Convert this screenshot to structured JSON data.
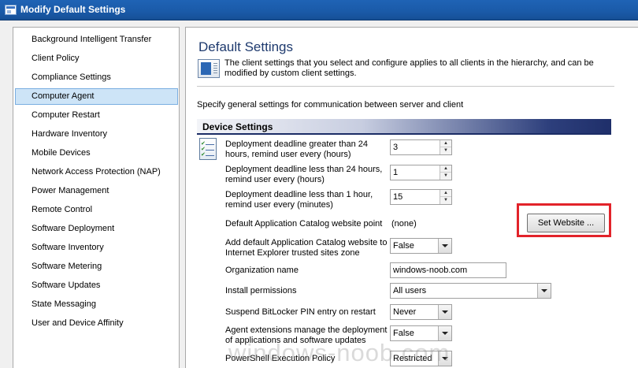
{
  "window": {
    "title": "Modify Default Settings"
  },
  "sidebar": {
    "items": [
      {
        "label": "Background Intelligent Transfer"
      },
      {
        "label": "Client Policy"
      },
      {
        "label": "Compliance Settings"
      },
      {
        "label": "Computer Agent",
        "selected": true
      },
      {
        "label": "Computer Restart"
      },
      {
        "label": "Hardware Inventory"
      },
      {
        "label": "Mobile Devices"
      },
      {
        "label": "Network Access Protection (NAP)"
      },
      {
        "label": "Power Management"
      },
      {
        "label": "Remote Control"
      },
      {
        "label": "Software Deployment"
      },
      {
        "label": "Software Inventory"
      },
      {
        "label": "Software Metering"
      },
      {
        "label": "Software Updates"
      },
      {
        "label": "State Messaging"
      },
      {
        "label": "User and Device Affinity"
      }
    ]
  },
  "main": {
    "heading": "Default Settings",
    "description": "The client settings that you select and configure applies to all clients in the hierarchy, and can be modified by custom client settings.",
    "subdescription": "Specify general settings for communication between server and client",
    "section_title": "Device Settings",
    "settings": {
      "deadline_gt24": {
        "label": "Deployment deadline greater than 24 hours, remind user every (hours)",
        "value": "3"
      },
      "deadline_lt24": {
        "label": "Deployment deadline less than 24 hours, remind user every (hours)",
        "value": "1"
      },
      "deadline_lt1": {
        "label": "Deployment deadline less than 1 hour, remind user every (minutes)",
        "value": "15"
      },
      "catalog_point": {
        "label": "Default Application Catalog website point",
        "value": "(none)",
        "button": "Set Website ..."
      },
      "add_trusted": {
        "label": "Add default Application Catalog website to Internet Explorer trusted sites zone",
        "value": "False"
      },
      "org_name": {
        "label": "Organization name",
        "value": "windows-noob.com"
      },
      "install_perm": {
        "label": "Install permissions",
        "value": "All users"
      },
      "suspend_bitlocker": {
        "label": "Suspend BitLocker PIN entry on restart",
        "value": "Never"
      },
      "agent_ext": {
        "label": "Agent extensions manage the deployment of applications and software updates",
        "value": "False"
      },
      "ps_policy": {
        "label": "PowerShell Execution Policy",
        "value": "Restricted"
      }
    }
  },
  "watermark": "windows-noob.com"
}
